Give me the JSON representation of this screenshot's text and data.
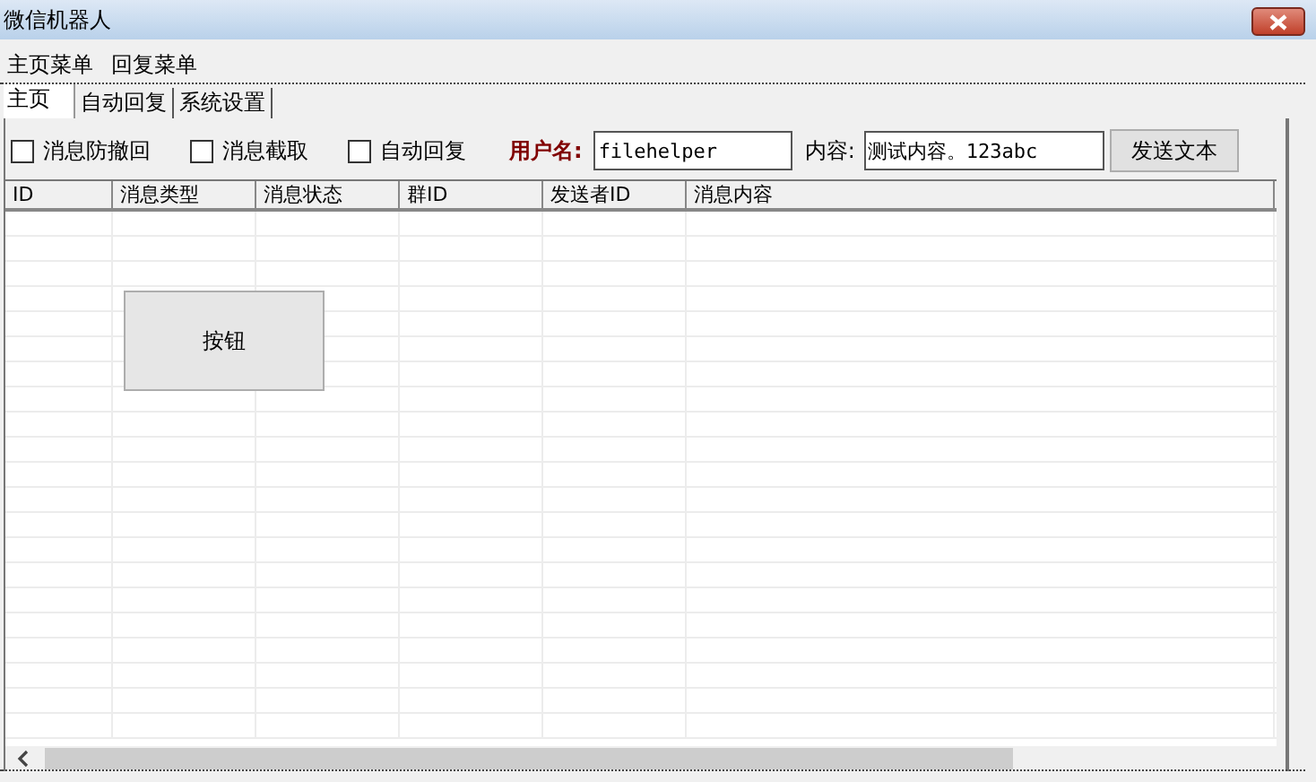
{
  "window": {
    "title": "微信机器人"
  },
  "menu": [
    "主页菜单",
    "回复菜单"
  ],
  "tabs": [
    {
      "label": "主页",
      "selected": true
    },
    {
      "label": "自动回复",
      "selected": false
    },
    {
      "label": "系统设置",
      "selected": false
    }
  ],
  "checkboxes": [
    {
      "label": "消息防撤回",
      "checked": false
    },
    {
      "label": "消息截取",
      "checked": false
    },
    {
      "label": "自动回复",
      "checked": false
    }
  ],
  "user_field": {
    "label": "用户名:",
    "value": "filehelper"
  },
  "content_field": {
    "label": "内容:",
    "value": "测试内容。123abc"
  },
  "send_button": "发送文本",
  "table": {
    "columns": [
      "ID",
      "消息类型",
      "消息状态",
      "群ID",
      "发送者ID",
      "消息内容"
    ]
  },
  "canvas_button": "按钮"
}
